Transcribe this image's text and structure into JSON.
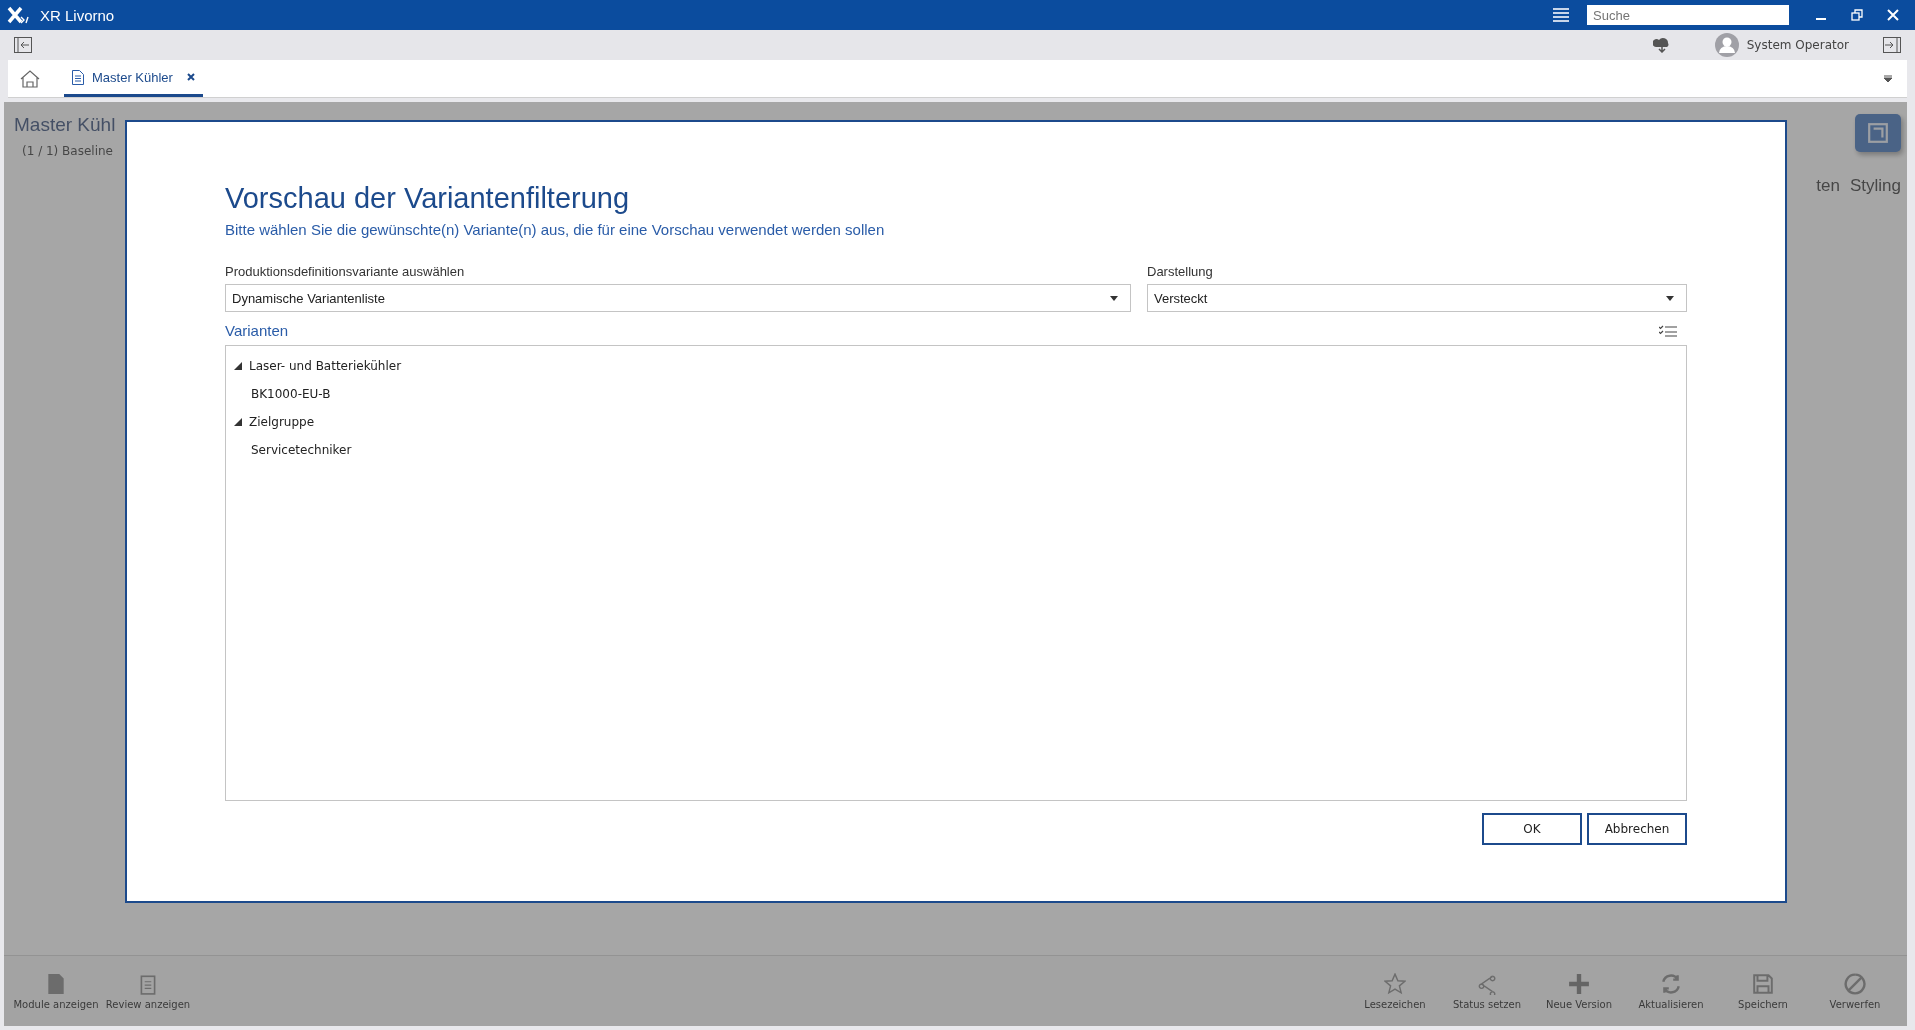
{
  "window": {
    "title": "XR Livorno",
    "search": {
      "placeholder": "Suche"
    }
  },
  "toolbar": {
    "user": "System Operator"
  },
  "tabs": [
    {
      "label": "Master Kühler",
      "selected": true
    }
  ],
  "background_page": {
    "title": "Master Kühl",
    "subtitle": "(1 / 1) Baseline",
    "right_tabs": [
      "ten",
      "Styling"
    ],
    "actions_left": [
      {
        "label": "Module anzeigen",
        "kind": "doc"
      },
      {
        "label": "Review anzeigen",
        "kind": "clipboard"
      }
    ],
    "actions_right": [
      {
        "label": "Lesezeichen",
        "kind": "star"
      },
      {
        "label": "Status setzen",
        "kind": "share"
      },
      {
        "label": "Neue Version",
        "kind": "plus"
      },
      {
        "label": "Aktualisieren",
        "kind": "refresh"
      },
      {
        "label": "Speichern",
        "kind": "save"
      },
      {
        "label": "Verwerfen",
        "kind": "cancel"
      }
    ]
  },
  "dialog": {
    "title": "Vorschau der Variantenfilterung",
    "subtitle": "Bitte wählen Sie die gewünschte(n) Variante(n) aus, die für eine Vorschau verwendet werden sollen",
    "fields": [
      {
        "label": "Produktionsdefinitionsvariante auswählen",
        "value": "Dynamische Variantenliste"
      },
      {
        "label": "Darstellung",
        "value": "Versteckt"
      }
    ],
    "variants_title": "Varianten",
    "tree": [
      {
        "label": "Laser- und Batteriekühler",
        "expanded": true,
        "children": [
          {
            "label": "BK1000-EU-B"
          }
        ]
      },
      {
        "label": "Zielgruppe",
        "expanded": true,
        "children": [
          {
            "label": "Servicetechniker"
          }
        ]
      }
    ],
    "buttons": [
      "OK",
      "Abbrechen"
    ]
  }
}
